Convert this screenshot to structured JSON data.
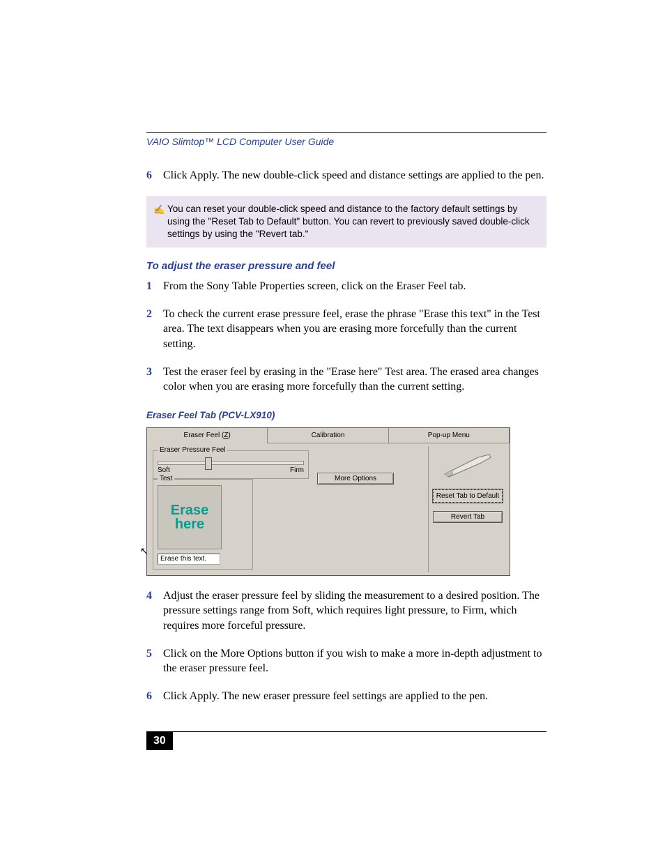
{
  "header": {
    "title": "VAIO Slimtop™ LCD Computer User Guide"
  },
  "top_step": {
    "num": "6",
    "text": "Click Apply. The new double-click speed and distance settings are applied to the pen."
  },
  "note": {
    "text": "You can reset your double-click speed and distance to the factory default settings by using the \"Reset Tab to Default\" button. You can revert to previously saved double-click settings by using the \"Revert tab.\""
  },
  "section_heading": "To adjust the eraser pressure and feel",
  "steps_a": [
    {
      "num": "1",
      "text": "From the Sony Table Properties screen, click on the Eraser Feel tab."
    },
    {
      "num": "2",
      "text": "To check the current erase pressure feel, erase the phrase \"Erase this text\" in the Test area. The text disappears when you are erasing more forcefully than the current setting."
    },
    {
      "num": "3",
      "text": "Test the eraser feel by erasing in the \"Erase here\" Test area. The erased area changes color when you are erasing more forcefully than the current setting."
    }
  ],
  "caption": "Eraser Feel Tab (PCV-LX910)",
  "ui": {
    "tabs": {
      "eraser": "Eraser Feel",
      "eraser_key": "Z",
      "calibration": "Calibration",
      "popup": "Pop-up Menu"
    },
    "group_pressure": "raser Pressure Feel",
    "pressure_key": "E",
    "soft": "Soft",
    "firm": "Firm",
    "group_test": "Test",
    "erase_here": "Erase here",
    "erase_input": "Erase this text.",
    "more_options": "More Options",
    "reset": "Reset Tab to Default",
    "revert": "Revert Tab"
  },
  "steps_b": [
    {
      "num": "4",
      "text": "Adjust the eraser pressure feel by sliding the measurement to a desired position. The pressure settings range from Soft, which requires light pressure, to Firm, which requires more forceful pressure."
    },
    {
      "num": "5",
      "text": "Click on the More Options button if you wish to make a more in-depth adjustment to the eraser pressure feel."
    },
    {
      "num": "6",
      "text": "Click Apply. The new eraser pressure feel settings are applied to the pen."
    }
  ],
  "page_number": "30"
}
